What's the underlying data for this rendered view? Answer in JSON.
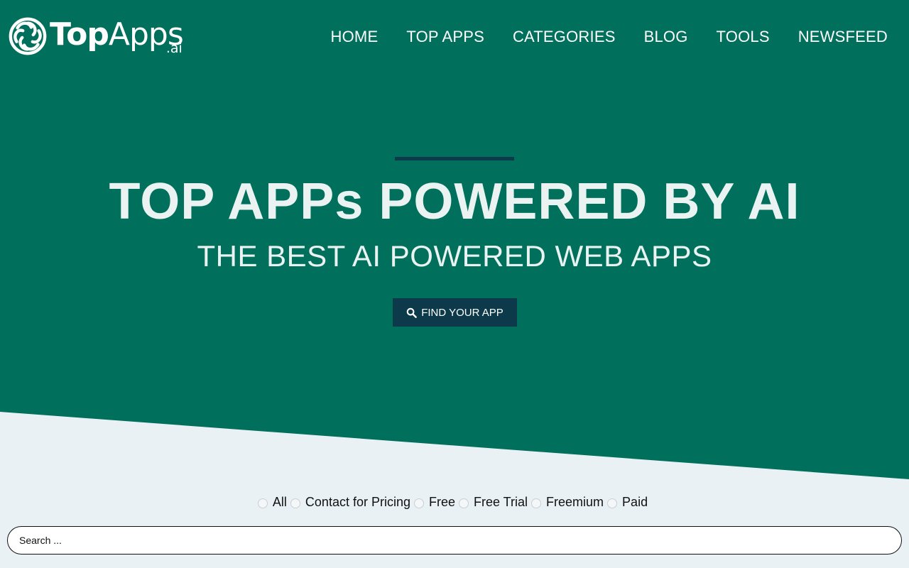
{
  "logo": {
    "top": "Top",
    "apps": "Apps",
    "tld": ".ai",
    "icon": "openai-knot-icon"
  },
  "nav": {
    "items": [
      {
        "label": "HOME"
      },
      {
        "label": "TOP APPS"
      },
      {
        "label": "CATEGORIES"
      },
      {
        "label": "BLOG"
      },
      {
        "label": "TOOLS"
      },
      {
        "label": "NEWSFEED"
      }
    ]
  },
  "hero": {
    "headline": "TOP APPs POWERED BY AI",
    "subheadline": "THE BEST AI POWERED WEB APPS",
    "cta": {
      "label": "FIND YOUR APP",
      "icon": "search-icon"
    }
  },
  "filters": {
    "options": [
      {
        "label": "All"
      },
      {
        "label": "Contact for Pricing"
      },
      {
        "label": "Free"
      },
      {
        "label": "Free Trial"
      },
      {
        "label": "Freemium"
      },
      {
        "label": "Paid"
      }
    ]
  },
  "search": {
    "placeholder": "Search ...",
    "value": ""
  },
  "colors": {
    "hero_green": "#006f5b",
    "accent_navy": "#0c3a4a",
    "page_bg": "#eaf1f4",
    "text_light": "#eaf3f2"
  }
}
